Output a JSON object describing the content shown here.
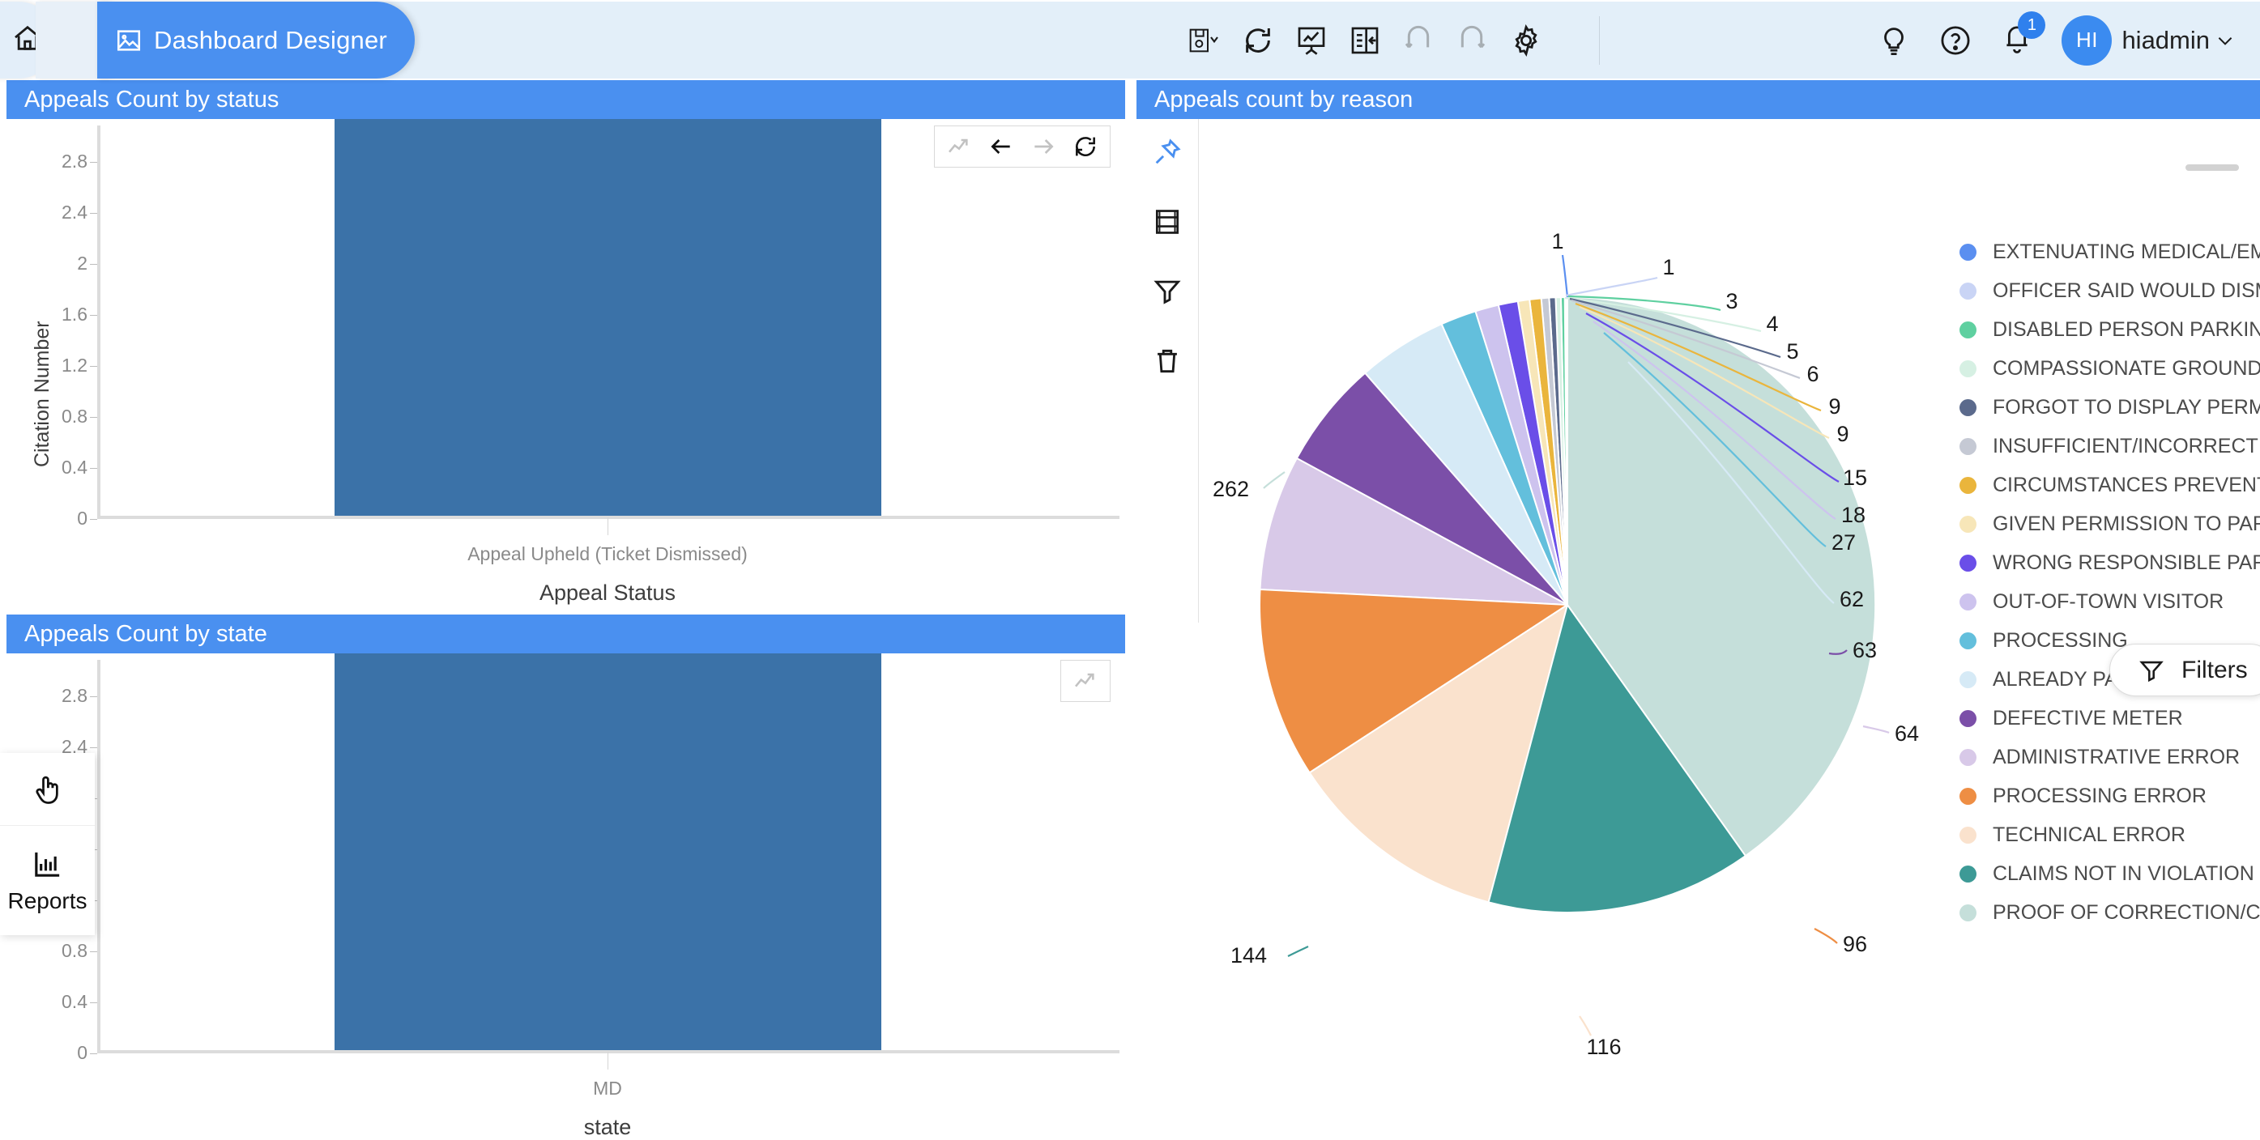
{
  "topbar": {
    "home_icon": "home-icon",
    "chevron_icon": "chevron-right-icon",
    "active_tab": "Dashboard Designer",
    "active_tab_icon": "image-chart-icon",
    "tools": [
      {
        "name": "save-dropdown-icon",
        "label": "Save"
      },
      {
        "name": "refresh-icon",
        "label": "Refresh"
      },
      {
        "name": "presentation-icon",
        "label": "Presentation"
      },
      {
        "name": "panel-collapse-icon",
        "label": "Panel"
      },
      {
        "name": "undo-icon",
        "label": "Undo"
      },
      {
        "name": "redo-icon",
        "label": "Redo"
      },
      {
        "name": "gear-icon",
        "label": "Settings"
      }
    ],
    "right_tools": [
      {
        "name": "lightbulb-icon",
        "label": "Tips"
      },
      {
        "name": "help-icon",
        "label": "Help"
      },
      {
        "name": "bell-icon",
        "label": "Notifications"
      }
    ],
    "notification_count": "1",
    "avatar_initials": "HI",
    "user_name": "hiadmin",
    "user_chevron": "chevron-down-icon",
    "accent_color": "#4a90f0"
  },
  "panels": {
    "status": {
      "title": "Appeals Count by status",
      "tools": [
        {
          "name": "trend-icon",
          "state": "disabled"
        },
        {
          "name": "back-arrow-icon",
          "state": "active"
        },
        {
          "name": "forward-arrow-icon",
          "state": "disabled"
        },
        {
          "name": "refresh-icon",
          "state": "active"
        }
      ]
    },
    "state": {
      "title": "Appeals Count by state",
      "tools": [
        {
          "name": "trend-icon",
          "state": "disabled"
        }
      ]
    },
    "reason": {
      "title": "Appeals count by reason",
      "rail": [
        {
          "name": "pin-icon",
          "color": "#4a90f0"
        },
        {
          "name": "table-icon",
          "color": "#1a1a1a"
        },
        {
          "name": "filter-icon",
          "color": "#1a1a1a"
        },
        {
          "name": "trash-icon",
          "color": "#1a1a1a"
        }
      ]
    }
  },
  "filters_button": {
    "label": "Filters",
    "icon": "filter-icon"
  },
  "left_flyout": {
    "items": [
      {
        "name": "pointer-icon",
        "label": ""
      },
      {
        "name": "reports-icon",
        "label": "Reports"
      }
    ]
  },
  "chart_data": [
    {
      "type": "bar",
      "title": "Appeals Count by status",
      "categories": [
        "Appeal Upheld (Ticket Dismissed)"
      ],
      "values": [
        3
      ],
      "xlabel": "Appeal Status",
      "ylabel": "Citation Number",
      "ylim": [
        0,
        3
      ],
      "yticks": [
        "0",
        "0.4",
        "0.8",
        "1.2",
        "1.6",
        "2",
        "2.4",
        "2.8"
      ],
      "grid": false,
      "bar_color": "#3b72a8"
    },
    {
      "type": "bar",
      "title": "Appeals Count by state",
      "categories": [
        "MD"
      ],
      "values": [
        3
      ],
      "xlabel": "state",
      "ylabel": "Citation Number",
      "ylim": [
        0,
        3
      ],
      "yticks": [
        "0",
        "0.4",
        "0.8",
        "1.2",
        "1.6",
        "2",
        "2.4",
        "2.8"
      ],
      "grid": false,
      "bar_color": "#3b72a8"
    },
    {
      "type": "pie",
      "title": "Appeals count by reason",
      "legend_position": "right",
      "labels": [
        "EXTENUATING MEDICAL/EME",
        "OFFICER SAID WOULD DISMI",
        "DISABLED PERSON PARKING",
        "COMPASSIONATE GROUNDS",
        "FORGOT TO DISPLAY PERMIT",
        "INSUFFICIENT/INCORRECT S",
        "CIRCUMSTANCES PREVENTE",
        "GIVEN PERMISSION TO PARK",
        "WRONG RESPONSIBLE PART",
        "OUT-OF-TOWN VISITOR",
        "PROCESSING",
        "ALREADY PAID CITATION",
        "DEFECTIVE METER",
        "ADMINISTRATIVE ERROR",
        "PROCESSING ERROR",
        "TECHNICAL ERROR",
        "CLAIMS NOT IN VIOLATION",
        "PROOF OF CORRECTION/CO"
      ],
      "values": [
        1,
        1,
        3,
        4,
        5,
        6,
        9,
        9,
        15,
        18,
        27,
        62,
        63,
        64,
        96,
        116,
        144,
        262
      ],
      "colors": [
        "#5b8ff0",
        "#c9d4f5",
        "#5fd0a0",
        "#d6f0e3",
        "#5b6a8c",
        "#c5c9d4",
        "#eab53c",
        "#f7e6b8",
        "#6a4ee8",
        "#cdc3ee",
        "#63bfdc",
        "#d6eaf6",
        "#7b4fa8",
        "#d8c9e8",
        "#ee8e44",
        "#fae2cd",
        "#3d9a96",
        "#c5dfda"
      ]
    }
  ]
}
